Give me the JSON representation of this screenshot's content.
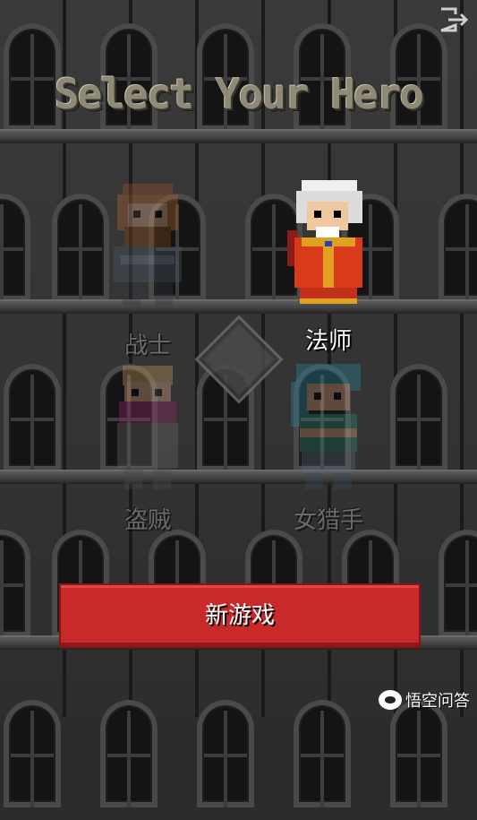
{
  "title": "Select Your Hero",
  "heroes": [
    {
      "name": "战士",
      "state": "locked"
    },
    {
      "name": "法师",
      "state": "selected"
    },
    {
      "name": "盗贼",
      "state": "locked"
    },
    {
      "name": "女猎手",
      "state": "locked"
    }
  ],
  "button": {
    "label": "新游戏"
  },
  "watermark": {
    "text": "悟空问答"
  },
  "icons": {
    "exit": "exit-icon",
    "badge": "challenge-badge-icon"
  },
  "colors": {
    "button": "#c82a2a",
    "title": "#8f8a78",
    "background": "#2b2b2b"
  }
}
